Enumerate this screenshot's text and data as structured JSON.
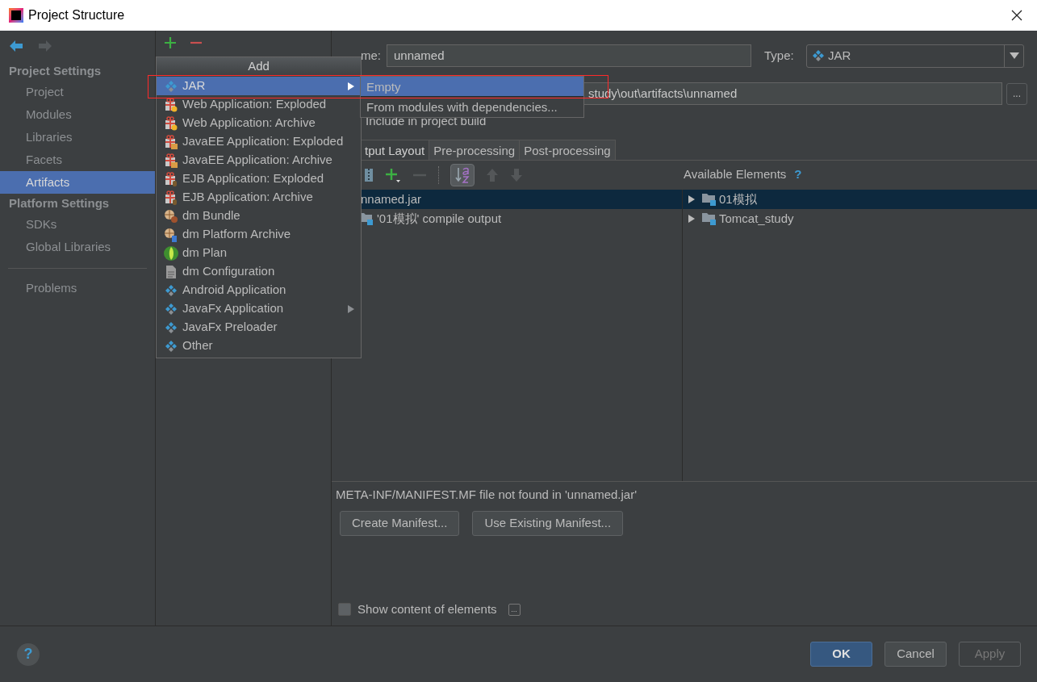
{
  "window": {
    "title": "Project Structure"
  },
  "sidebar": {
    "sections": [
      {
        "title": "Project Settings",
        "items": [
          {
            "label": "Project",
            "selected": false
          },
          {
            "label": "Modules",
            "selected": false
          },
          {
            "label": "Libraries",
            "selected": false
          },
          {
            "label": "Facets",
            "selected": false
          },
          {
            "label": "Artifacts",
            "selected": true
          }
        ]
      },
      {
        "title": "Platform Settings",
        "items": [
          {
            "label": "SDKs",
            "selected": false
          },
          {
            "label": "Global Libraries",
            "selected": false
          }
        ]
      }
    ],
    "extra_items": [
      {
        "label": "Problems",
        "selected": false
      }
    ]
  },
  "add_menu": {
    "title": "Add",
    "items": [
      {
        "label": "JAR",
        "kind": "jar",
        "selected": true,
        "submenu": true
      },
      {
        "label": "Web Application: Exploded",
        "kind": "web",
        "selected": false,
        "submenu": false
      },
      {
        "label": "Web Application: Archive",
        "kind": "web",
        "selected": false,
        "submenu": false
      },
      {
        "label": "JavaEE Application: Exploded",
        "kind": "javaee",
        "selected": false,
        "submenu": false
      },
      {
        "label": "JavaEE Application: Archive",
        "kind": "javaee",
        "selected": false,
        "submenu": false
      },
      {
        "label": "EJB Application: Exploded",
        "kind": "ejb",
        "selected": false,
        "submenu": false
      },
      {
        "label": "EJB Application: Archive",
        "kind": "ejb",
        "selected": false,
        "submenu": false
      },
      {
        "label": "dm Bundle",
        "kind": "bundle",
        "selected": false,
        "submenu": false
      },
      {
        "label": "dm Platform Archive",
        "kind": "platform",
        "selected": false,
        "submenu": false
      },
      {
        "label": "dm Plan",
        "kind": "plan",
        "selected": false,
        "submenu": false
      },
      {
        "label": "dm Configuration",
        "kind": "config",
        "selected": false,
        "submenu": false
      },
      {
        "label": "Android Application",
        "kind": "jar",
        "selected": false,
        "submenu": false
      },
      {
        "label": "JavaFx Application",
        "kind": "jar",
        "selected": false,
        "submenu": true
      },
      {
        "label": "JavaFx Preloader",
        "kind": "jar",
        "selected": false,
        "submenu": false
      },
      {
        "label": "Other",
        "kind": "jar",
        "selected": false,
        "submenu": false
      }
    ]
  },
  "submenu": {
    "items": [
      {
        "label": "Empty",
        "selected": true
      },
      {
        "label": "From modules with dependencies...",
        "selected": false
      }
    ]
  },
  "artifact": {
    "name_label": "me:",
    "name_value": "unnamed",
    "type_label": "Type:",
    "type_value": "JAR",
    "output_dir": "study\\out\\artifacts\\unnamed",
    "browse": "...",
    "include_label": "Include in project build"
  },
  "tabs": [
    {
      "label": "tput Layout",
      "selected": true
    },
    {
      "label": "Pre-processing",
      "selected": false
    },
    {
      "label": "Post-processing",
      "selected": false
    }
  ],
  "toolbar": [
    {
      "kind": "archive",
      "disabled": false
    },
    {
      "kind": "add",
      "disabled": false
    },
    {
      "kind": "remove",
      "disabled": true
    },
    {
      "kind": "sort",
      "disabled": false,
      "on": true
    },
    {
      "kind": "up",
      "disabled": true
    },
    {
      "kind": "down",
      "disabled": true
    }
  ],
  "layout_tree": [
    {
      "label": "nnamed.jar",
      "selected": true,
      "children": [
        {
          "label": "'01模拟' compile output",
          "selected": false
        }
      ]
    }
  ],
  "available": {
    "title": "Available Elements",
    "help": "?",
    "items": [
      {
        "label": "01模拟",
        "selected": true,
        "expanded": false
      },
      {
        "label": "Tomcat_study",
        "selected": false,
        "expanded": false
      }
    ]
  },
  "manifest": {
    "message": "META-INF/MANIFEST.MF file not found in 'unnamed.jar'",
    "buttons": [
      "Create Manifest...",
      "Use Existing Manifest..."
    ]
  },
  "show_content": {
    "label": "Show content of elements",
    "checked": false,
    "more": "..."
  },
  "help_button": "?",
  "buttons": [
    {
      "label": "OK",
      "default": true,
      "disabled": false
    },
    {
      "label": "Cancel",
      "default": false,
      "disabled": false
    },
    {
      "label": "Apply",
      "default": false,
      "disabled": true
    }
  ]
}
